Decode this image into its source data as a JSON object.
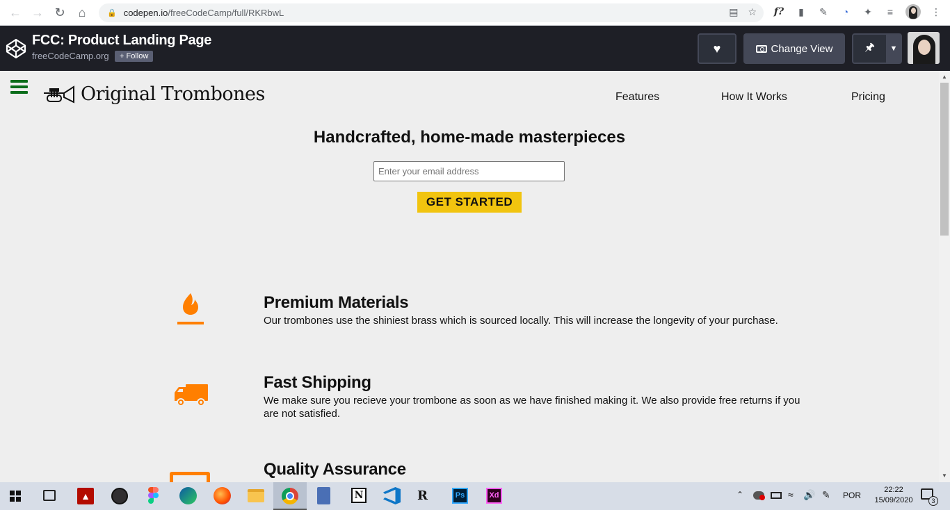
{
  "browser": {
    "url_host": "codepen.io",
    "url_path": "/freeCodeCamp/full/RKRbwL",
    "extensions": [
      "translate-icon",
      "star-icon",
      "f-question-icon",
      "reader-icon",
      "eyedropper-icon",
      "clock-ext-icon",
      "puzzle-icon",
      "playlist-icon",
      "profile-avatar",
      "menu-dots-icon"
    ],
    "ext_f_label": "f?"
  },
  "codepen": {
    "title": "FCC: Product Landing Page",
    "author": "freeCodeCamp.org",
    "follow_label": "+ Follow",
    "change_view_label": "Change View"
  },
  "site": {
    "brand": "Original Trombones",
    "nav": [
      "Features",
      "How It Works",
      "Pricing"
    ],
    "hero_title": "Handcrafted, home-made masterpieces",
    "email_placeholder": "Enter your email address",
    "cta_label": "GET STARTED",
    "accent_color": "#f1c40f",
    "icon_color": "#ff7f00",
    "features": [
      {
        "icon": "fire-icon",
        "title": "Premium Materials",
        "text": "Our trombones use the shiniest brass which is sourced locally. This will increase the longevity of your purchase."
      },
      {
        "icon": "truck-icon",
        "title": "Fast Shipping",
        "text": "We make sure you recieve your trombone as soon as we have finished making it. We also provide free returns if you are not satisfied."
      },
      {
        "icon": "battery-icon",
        "title": "Quality Assurance",
        "text": ""
      }
    ]
  },
  "taskbar": {
    "language": "POR",
    "time": "22:22",
    "date": "15/09/2020",
    "notifications": "3",
    "apps": [
      "windows-start-icon",
      "task-view-icon",
      "acrobat-icon",
      "obs-icon",
      "figma-icon",
      "edge-icon",
      "firefox-icon",
      "file-explorer-icon",
      "chrome-icon",
      "calculator-icon",
      "notion-icon",
      "vscode-icon",
      "rstudio-icon",
      "photoshop-icon",
      "adobe-xd-icon"
    ]
  }
}
